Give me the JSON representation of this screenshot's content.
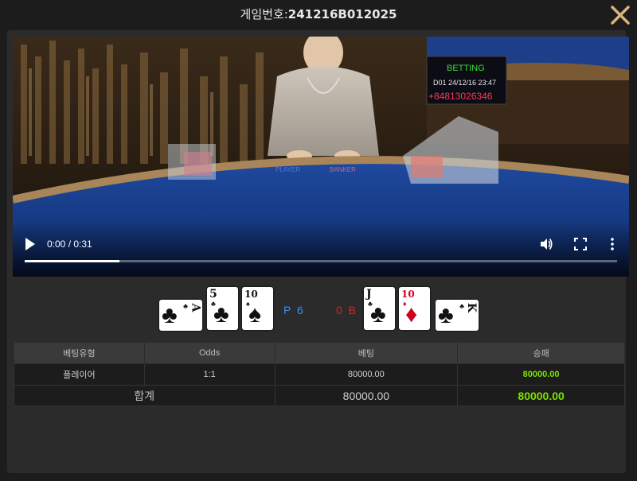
{
  "header": {
    "title_label": "게임번호:",
    "game_number": "241216B012025"
  },
  "video": {
    "time_display": "0:00 / 0:31",
    "progress": 0.16,
    "screen": {
      "line1": "BETTING",
      "line2": "D01 24/12/16 23:47",
      "line3": "+84813026346"
    },
    "table_text": {
      "player": "PLAYER",
      "banker": "BANKER"
    }
  },
  "result": {
    "player_cards": [
      {
        "rank": "A",
        "suit": "♣",
        "color": "black",
        "rotated": true
      },
      {
        "rank": "5",
        "suit": "♣",
        "color": "black",
        "rotated": false
      },
      {
        "rank": "10",
        "suit": "♠",
        "color": "black",
        "rotated": false
      }
    ],
    "player_score": "P 6",
    "banker_score": "0 B",
    "banker_cards": [
      {
        "rank": "J",
        "suit": "♣",
        "color": "black",
        "rotated": false
      },
      {
        "rank": "10",
        "suit": "♦",
        "color": "red",
        "rotated": false
      },
      {
        "rank": "K",
        "suit": "♣",
        "color": "black",
        "rotated": true
      }
    ]
  },
  "bet_table": {
    "headers": [
      "베팅유형",
      "Odds",
      "베팅",
      "승패"
    ],
    "rows": [
      {
        "type": "플레이어",
        "odds": "1:1",
        "bet": "80000.00",
        "win": "80000.00"
      }
    ],
    "total": {
      "label": "합계",
      "bet": "80000.00",
      "win": "80000.00"
    }
  },
  "colors": {
    "player": "#3a8ef0",
    "banker": "#e02020",
    "win": "#7ee000",
    "close": "#d9b47a"
  }
}
